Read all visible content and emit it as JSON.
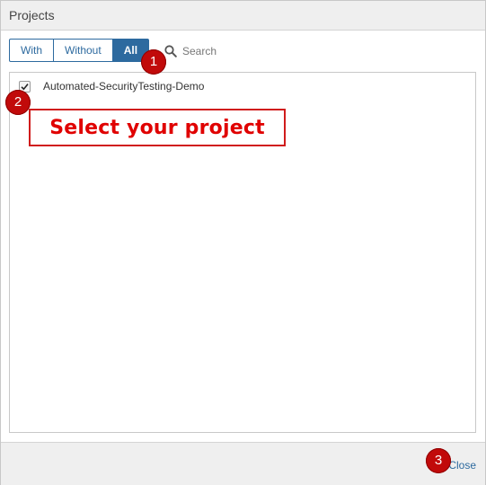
{
  "dialog": {
    "title": "Projects"
  },
  "filters": {
    "items": [
      {
        "label": "With",
        "active": false
      },
      {
        "label": "Without",
        "active": false
      },
      {
        "label": "All",
        "active": true
      }
    ]
  },
  "search": {
    "placeholder": "Search",
    "icon": "search-icon"
  },
  "projects": [
    {
      "name": "Automated-SecurityTesting-Demo",
      "checked": true
    }
  ],
  "annotations": {
    "callout_text": "Select your project",
    "badges": [
      "1",
      "2",
      "3"
    ],
    "color": "#c10a0a"
  },
  "footer": {
    "close_label": "Close"
  },
  "colors": {
    "accent": "#2d6a9f",
    "annotation_red": "#e00000"
  }
}
